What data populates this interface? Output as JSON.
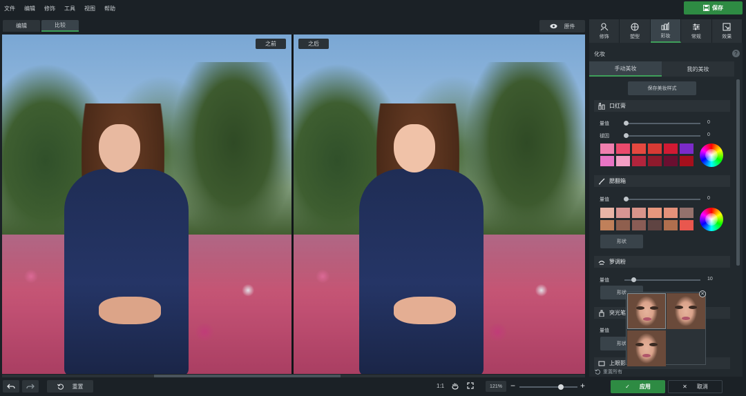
{
  "menu": [
    "文件",
    "编辑",
    "修饰",
    "工具",
    "视图",
    "帮助"
  ],
  "save_label": "保存",
  "view_tabs": [
    {
      "label": "编辑"
    },
    {
      "label": "比较",
      "active": true
    }
  ],
  "original_label": "原件",
  "photos": {
    "before_label": "之前",
    "after_label": "之后"
  },
  "bottom": {
    "reset_label": "重置",
    "zoom_ratio": "1:1",
    "zoom_percent": "121%",
    "zoom_level_fraction": 0.72,
    "apply_label": "应用",
    "cancel_label": "取消"
  },
  "panel": {
    "tool_tabs": [
      {
        "label": "修饰",
        "icon": "retouch-icon"
      },
      {
        "label": "塑型",
        "icon": "reshape-icon"
      },
      {
        "label": "彩妆",
        "icon": "makeup-icon",
        "active": true
      },
      {
        "label": "常规",
        "icon": "sliders-icon"
      },
      {
        "label": "效果",
        "icon": "effects-icon"
      }
    ],
    "section_title": "化妆",
    "sub_tabs": [
      {
        "label": "手动美妆",
        "active": true
      },
      {
        "label": "我的美妆"
      }
    ],
    "save_style_label": "保存美妆样式",
    "lipstick": {
      "title": "口红膏",
      "amount_label": "量值",
      "amount_value": "0",
      "saturation_label": "褪因",
      "saturation_value": "0",
      "colors": [
        "#f07fae",
        "#ea4a6c",
        "#e5483f",
        "#d83a34",
        "#d11a33",
        "#7b2bc9",
        "#e874c4",
        "#f39fc4",
        "#b3243c",
        "#8e1a2c",
        "#6a0f30",
        "#a50f1c"
      ]
    },
    "blush": {
      "title": "腮翻箱",
      "amount_label": "量值",
      "amount_value": "0",
      "colors": [
        "#e9b4a6",
        "#d79593",
        "#d8948a",
        "#e7977d",
        "#e4917a",
        "#94716c",
        "#c0805a",
        "#8f5f4e",
        "#8a5c55",
        "#5f4442",
        "#b06f4e",
        "#e9574e"
      ],
      "shape_label": "形状"
    },
    "eyeshadow": {
      "title": "箩调粉",
      "amount_label": "量值",
      "amount_value": "10",
      "shape_label": "形状"
    },
    "highlight": {
      "title": "突光笔",
      "amount_label": "量值",
      "shape_label": "形状"
    },
    "next_title": "上眼影",
    "reset_all_label": "重置所有"
  }
}
